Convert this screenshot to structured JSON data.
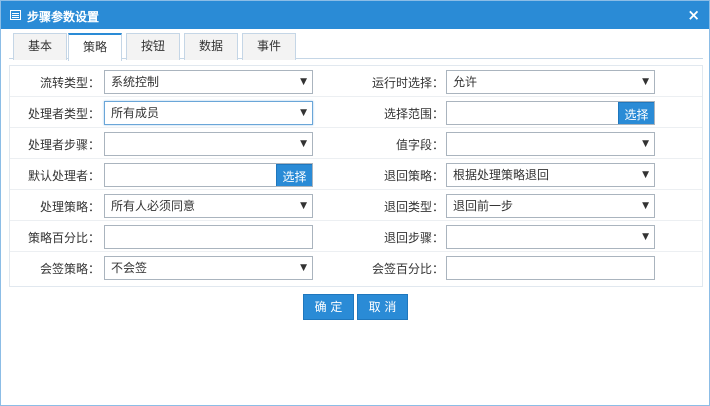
{
  "window": {
    "title": "步骤参数设置",
    "close": "×"
  },
  "tabs": [
    {
      "label": "基本"
    },
    {
      "label": "策略"
    },
    {
      "label": "按钮"
    },
    {
      "label": "数据"
    },
    {
      "label": "事件"
    }
  ],
  "form": {
    "flow_type": {
      "label": "流转类型：",
      "value": "系统控制"
    },
    "runtime_select": {
      "label": "运行时选择：",
      "value": "允许"
    },
    "handler_type": {
      "label": "处理者类型：",
      "value": "所有成员"
    },
    "select_range": {
      "label": "选择范围：",
      "value": "",
      "button": "选择"
    },
    "handler_step": {
      "label": "处理者步骤：",
      "value": ""
    },
    "value_field": {
      "label": "值字段：",
      "value": ""
    },
    "default_handler": {
      "label": "默认处理者：",
      "value": "",
      "button": "选择"
    },
    "return_strategy": {
      "label": "退回策略：",
      "value": "根据处理策略退回"
    },
    "handling_strategy": {
      "label": "处理策略：",
      "value": "所有人必须同意"
    },
    "return_type": {
      "label": "退回类型：",
      "value": "退回前一步"
    },
    "strategy_percent": {
      "label": "策略百分比：",
      "value": ""
    },
    "return_step": {
      "label": "退回步骤：",
      "value": ""
    },
    "countersign_strategy": {
      "label": "会签策略：",
      "value": "不会签"
    },
    "countersign_percent": {
      "label": "会签百分比：",
      "value": ""
    }
  },
  "footer": {
    "ok": "确 定",
    "cancel": "取 消"
  },
  "colors": {
    "accent": "#2a8bd6"
  },
  "icons": {
    "title": "window-icon",
    "dropdown": "chevron-down-icon"
  }
}
